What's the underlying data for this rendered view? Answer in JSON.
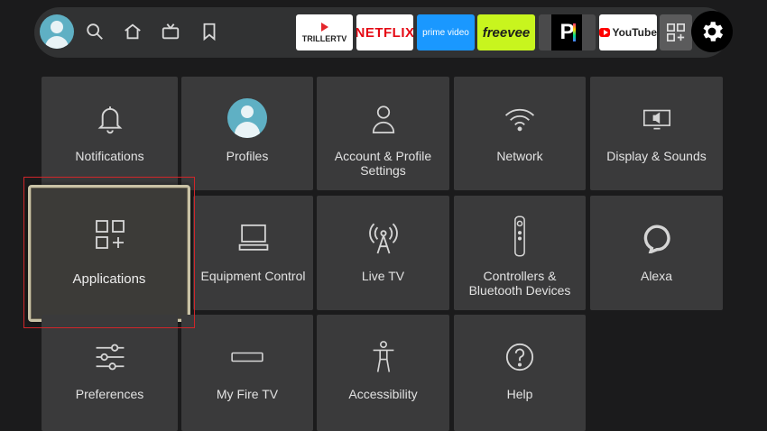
{
  "topbar": {
    "apps": [
      {
        "name": "trillertv",
        "label": "TRILLERTV",
        "bg": "#ffffff",
        "fg": "#222222"
      },
      {
        "name": "netflix",
        "label": "NETFLIX",
        "bg": "#ffffff",
        "fg": "#e50914"
      },
      {
        "name": "prime-video",
        "label": "prime video",
        "bg": "#1a98ff",
        "fg": "#ffffff"
      },
      {
        "name": "freevee",
        "label": "freevee",
        "bg": "#c8f51e",
        "fg": "#1c1c1c"
      },
      {
        "name": "pluto",
        "label": "P",
        "bg": "#000000",
        "fg": "#ffffff"
      },
      {
        "name": "youtube",
        "label": "YouTube",
        "bg": "#ffffff",
        "fg": "#222222"
      }
    ]
  },
  "tiles": [
    {
      "label": "Notifications",
      "icon": "bell-icon"
    },
    {
      "label": "Profiles",
      "icon": "profile-avatar-icon"
    },
    {
      "label": "Account & Profile Settings",
      "icon": "person-icon"
    },
    {
      "label": "Network",
      "icon": "wifi-icon"
    },
    {
      "label": "Display & Sounds",
      "icon": "display-sound-icon"
    },
    {
      "label": "Applications",
      "icon": "apps-grid-icon"
    },
    {
      "label": "Equipment Control",
      "icon": "tv-equipment-icon"
    },
    {
      "label": "Live TV",
      "icon": "antenna-icon"
    },
    {
      "label": "Controllers & Bluetooth Devices",
      "icon": "remote-icon"
    },
    {
      "label": "Alexa",
      "icon": "alexa-icon"
    },
    {
      "label": "Preferences",
      "icon": "sliders-icon"
    },
    {
      "label": "My Fire TV",
      "icon": "firetv-stick-icon"
    },
    {
      "label": "Accessibility",
      "icon": "accessibility-icon"
    },
    {
      "label": "Help",
      "icon": "help-icon"
    }
  ],
  "colors": {
    "focus_border": "#c9c2a6",
    "highlight": "#d0262a",
    "tile_bg": "#3a3a3b"
  }
}
